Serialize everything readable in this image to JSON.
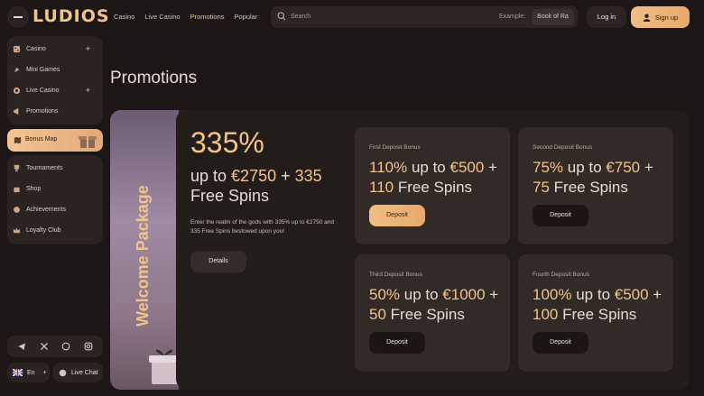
{
  "header": {
    "logo": "LUDIOS",
    "nav": [
      "Casino",
      "Live Casino",
      "Promotions",
      "Popular"
    ],
    "active_nav": "Promotions",
    "search_placeholder": "Search",
    "search_example_label": "Example:",
    "search_example_value": "Book of Ra",
    "login": "Log in",
    "signup": "Sign up"
  },
  "sidebar": {
    "top_items": [
      {
        "label": "Casino",
        "icon": "dice-icon",
        "expandable": true
      },
      {
        "label": "Mini Games",
        "icon": "rocket-icon",
        "expandable": false
      },
      {
        "label": "Live Casino",
        "icon": "chip-icon",
        "expandable": true
      },
      {
        "label": "Promotions",
        "icon": "megaphone-icon",
        "expandable": false
      }
    ],
    "bonus_map": "Bonus Map",
    "bottom_items": [
      {
        "label": "Tournaments",
        "icon": "trophy-icon"
      },
      {
        "label": "Shop",
        "icon": "bag-icon"
      },
      {
        "label": "Achievements",
        "icon": "medal-icon"
      },
      {
        "label": "Loyalty Club",
        "icon": "crown-icon"
      }
    ],
    "social": [
      "telegram-icon",
      "x-icon",
      "whatsapp-icon",
      "instagram-icon"
    ],
    "language": "En",
    "live_chat": "Live Chat"
  },
  "main": {
    "title": "Promotions",
    "welcome_label": "Welcome Package",
    "headline": "335%",
    "subheadline_parts": [
      "up to ",
      "€2750",
      " + ",
      "335",
      " Free Spins"
    ],
    "description": "Enter the realm of the gods with 335% up to €2750 and 335 Free Spins bestowed upon you!",
    "details_button": "Details",
    "cards": [
      {
        "label": "First Deposit Bonus",
        "highlight_1": "110%",
        "mid_1": " up to ",
        "highlight_2": "€500",
        "mid_2": " + ",
        "highlight_3": "110",
        "tail": " Free Spins",
        "button": "Deposit",
        "primary": true
      },
      {
        "label": "Second Deposit Bonus",
        "highlight_1": "75%",
        "mid_1": " up to ",
        "highlight_2": "€750",
        "mid_2": " + ",
        "highlight_3": "75",
        "tail": " Free Spins",
        "button": "Deposit",
        "primary": false
      },
      {
        "label": "Third Deposit Bonus",
        "highlight_1": "50%",
        "mid_1": " up to ",
        "highlight_2": "€1000",
        "mid_2": " + ",
        "highlight_3": "50",
        "tail": " Free Spins",
        "button": "Deposit",
        "primary": false
      },
      {
        "label": "Fourth Deposit Bonus",
        "highlight_1": "100%",
        "mid_1": " up to ",
        "highlight_2": "€500",
        "mid_2": " + ",
        "highlight_3": "100",
        "tail": " Free Spins",
        "button": "Deposit",
        "primary": false
      }
    ]
  },
  "colors": {
    "accent": "#f2c48a",
    "bg": "#1c1716",
    "panel": "#2a2321"
  }
}
